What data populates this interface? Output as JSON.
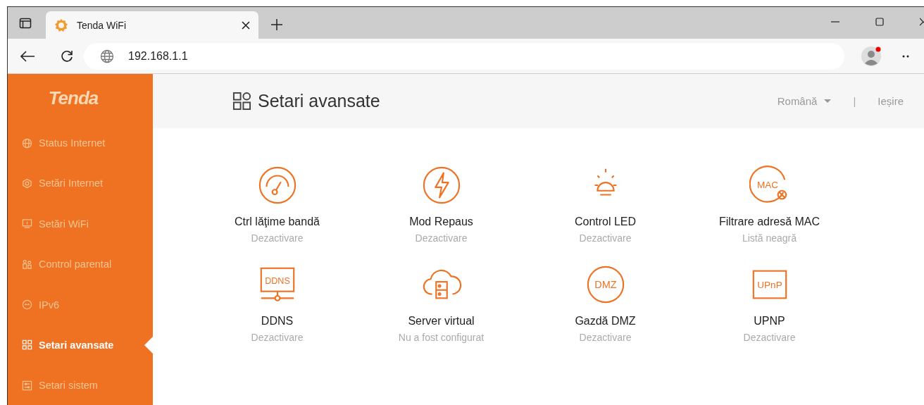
{
  "browser": {
    "tab_title": "Tenda WiFi",
    "address": "192.168.1.1"
  },
  "sidebar": {
    "logo": "Tenda",
    "items": [
      {
        "label": "Status Internet",
        "selected": false
      },
      {
        "label": "Setări Internet",
        "selected": false
      },
      {
        "label": "Setări WiFi",
        "selected": false
      },
      {
        "label": "Control parental",
        "selected": false
      },
      {
        "label": "IPv6",
        "selected": false
      },
      {
        "label": "Setari avansate",
        "selected": true
      },
      {
        "label": "Setari sistem",
        "selected": false
      }
    ]
  },
  "header": {
    "title": "Setari avansate",
    "language": "Română",
    "separator": "|",
    "logout": "Ieșire"
  },
  "features": [
    {
      "title": "Ctrl lăţime bandă",
      "status": "Dezactivare"
    },
    {
      "title": "Mod Repaus",
      "status": "Dezactivare"
    },
    {
      "title": "Control LED",
      "status": "Dezactivare"
    },
    {
      "title": "Filtrare adresă MAC",
      "status": "Listă neagră",
      "icon_text": "MAC"
    },
    {
      "title": "DDNS",
      "status": "Dezactivare",
      "icon_text": "DDNS"
    },
    {
      "title": "Server virtual",
      "status": "Nu a fost configurat"
    },
    {
      "title": "Gazdă DMZ",
      "status": "Dezactivare",
      "icon_text": "DMZ"
    },
    {
      "title": "UPNP",
      "status": "Dezactivare",
      "icon_text": "UPnP"
    }
  ]
}
